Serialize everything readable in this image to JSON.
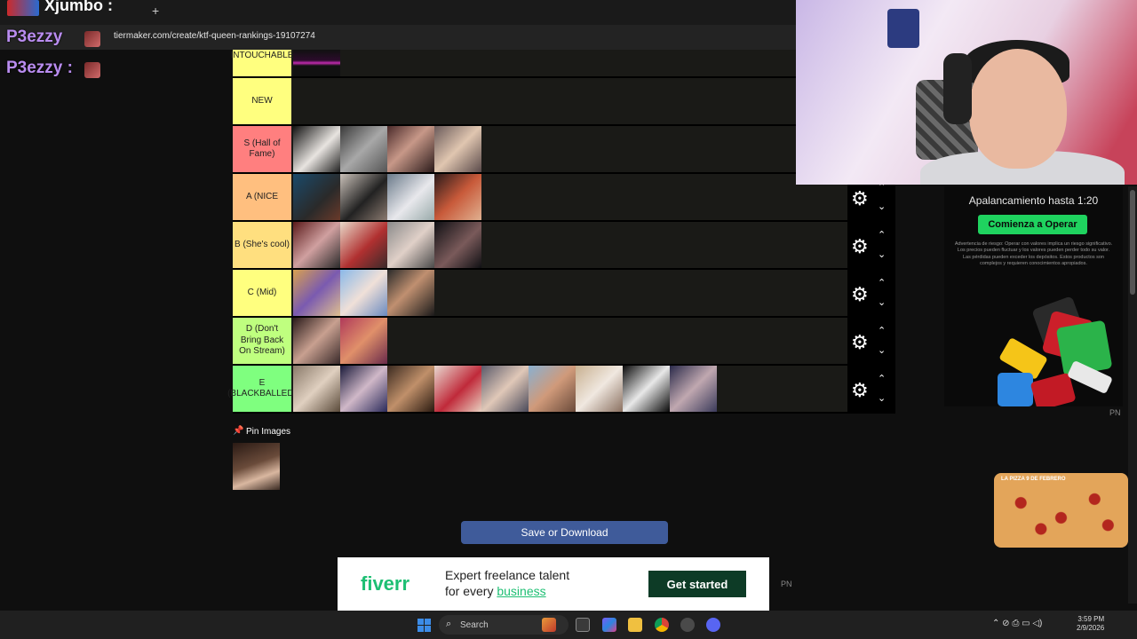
{
  "browser": {
    "url": "tiermaker.com/create/ktf-queen-rankings-19107274",
    "new_tab_label": "+"
  },
  "overlay": {
    "top_name": "Xjumbo :",
    "chat_name_1": "P3ezzy",
    "chat_name_2": "P3ezzy :"
  },
  "tiers": [
    {
      "label": "INTOUCHABLE",
      "color": "#ffff7f",
      "count": 1
    },
    {
      "label": "NEW",
      "color": "#ffff7f",
      "count": 0
    },
    {
      "label": "S (Hall of Fame)",
      "color": "#ff7f7f",
      "count": 4
    },
    {
      "label": "A (NICE",
      "color": "#ffbf7f",
      "count": 4
    },
    {
      "label": "B (She's cool)",
      "color": "#ffdf7f",
      "count": 4
    },
    {
      "label": "C (Mid)",
      "color": "#ffff7f",
      "count": 3
    },
    {
      "label": "D (Don't Bring Back On Stream)",
      "color": "#bfff7f",
      "count": 2
    },
    {
      "label": "E (BLACKBALLED)",
      "color": "#7fff7f",
      "count": 9
    }
  ],
  "controls": {
    "gear_icon": "gear-icon",
    "up_icon": "chevron-up-icon",
    "down_icon": "chevron-down-icon"
  },
  "pin": {
    "label": "Pin Images"
  },
  "save_button": "Save or Download",
  "ads": {
    "broker_title": "Apalancamiento hasta 1:20",
    "broker_button": "Comienza a Operar",
    "broker_disclaimer": "Advertencia de riesgo: Operar con valores implica un riesgo significativo. Los precios pueden fluctuar y los valores pueden perder todo su valor. Las pérdidas pueden exceder los depósitos. Estos productos son complejos y requieren conocimientos apropiados.",
    "pn_label": "PN",
    "pizza_text": "LA PIZZA 9 DE FEBRERO",
    "fiverr_logo": "fiverr",
    "fiverr_line1": "Expert freelance talent",
    "fiverr_line2_prefix": "for every ",
    "fiverr_line2_highlight": "business",
    "fiverr_button": "Get started",
    "pn_label_2": "PN"
  },
  "taskbar": {
    "search_label": "Search",
    "time": "3:59 PM",
    "date": "2/9/2026"
  }
}
